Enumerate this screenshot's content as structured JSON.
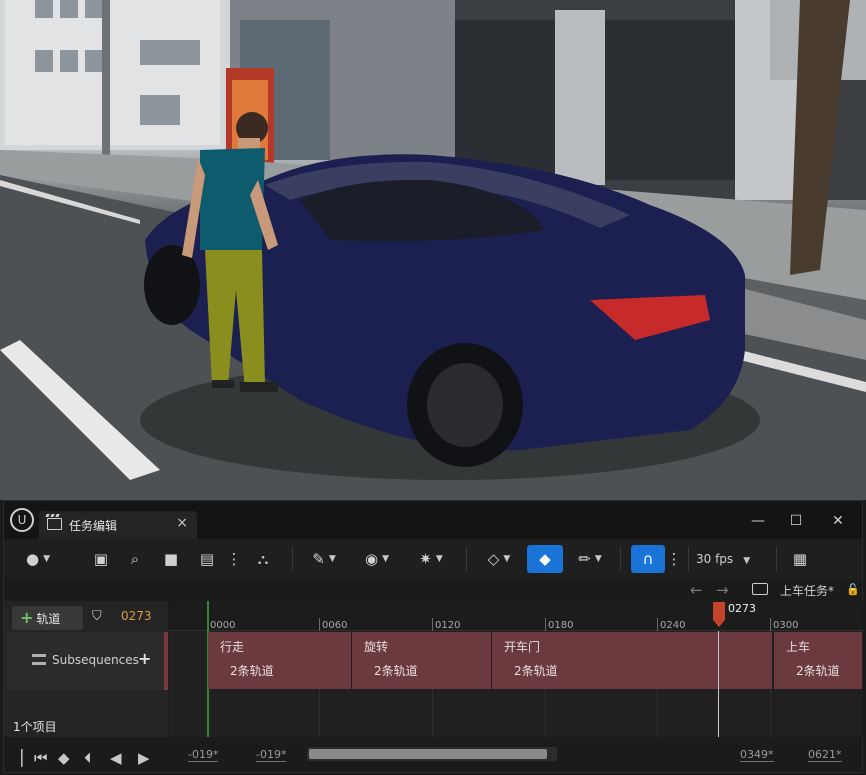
{
  "editor": {
    "tab_title": "任务编辑",
    "tab_close": "×",
    "window": {
      "minimize": "—",
      "maximize": "☐",
      "close": "✕"
    },
    "fps": "30 fps",
    "sequence_name": "上车任务*",
    "current_frame": "0273",
    "add_track_label": "轨道",
    "subsequences_label": "Subsequences",
    "item_count": "1个项目",
    "ruler_ticks": [
      "0000",
      "0060",
      "0120",
      "0180",
      "0240",
      "0300"
    ],
    "playhead_label": "0273",
    "sections": [
      {
        "name": "行走",
        "tracks": "2条轨道"
      },
      {
        "name": "旋转",
        "tracks": "2条轨道"
      },
      {
        "name": "开车门",
        "tracks": "2条轨道"
      },
      {
        "name": "上车",
        "tracks": "2条轨道"
      }
    ],
    "view_range_start": "-019*",
    "work_range_start": "-019*",
    "work_range_end": "0349*",
    "view_range_end": "0621*"
  },
  "colors": {
    "accent_blue": "#1a73d6",
    "section_fill": "#6b3a3f",
    "frame_orange": "#e09a3a",
    "playhead": "#c4442a"
  }
}
